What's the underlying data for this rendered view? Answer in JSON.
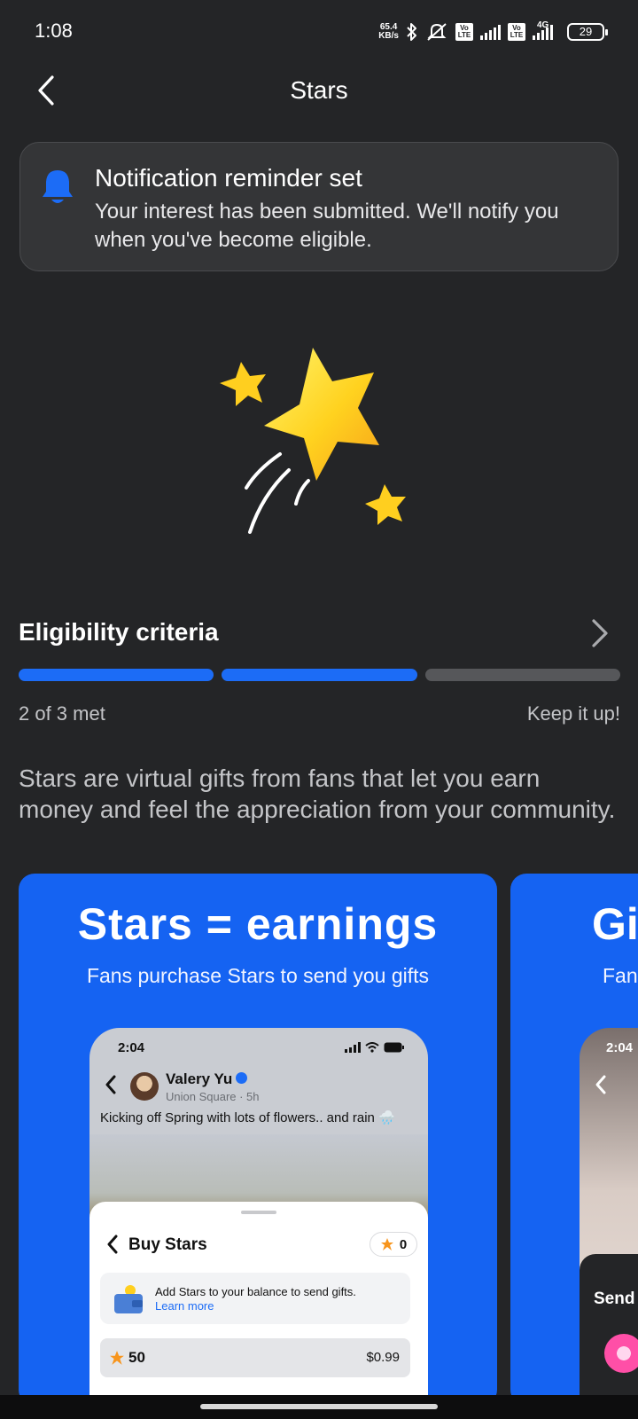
{
  "status_bar": {
    "time": "1:08",
    "net_speed_value": "65.4",
    "net_speed_unit": "KB/s",
    "battery": "29",
    "sim1_badge": "Vo LTE",
    "sim2_badge": "Vo LTE",
    "network": "4G"
  },
  "header": {
    "title": "Stars"
  },
  "notification": {
    "title": "Notification reminder set",
    "body": "Your interest has been submitted. We'll notify you when you've become eligible.",
    "icon": "bell-icon",
    "accent": "#1c6cf6"
  },
  "eligibility": {
    "title": "Eligibility criteria",
    "met_text": "2 of 3 met",
    "encouragement": "Keep it up!",
    "criteria_met": 2,
    "criteria_total": 3
  },
  "description": "Stars are virtual gifts from fans that let you earn money and feel the appreciation from your community.",
  "carousel": {
    "cards": [
      {
        "title": "Stars = earnings",
        "subtitle": "Fans purchase Stars to send you gifts",
        "mockup": {
          "time": "2:04",
          "user_name": "Valery Yu",
          "location": "Union Square · 5h",
          "post_text": "Kicking off Spring with lots of flowers.. and rain 🌧️",
          "sheet_title": "Buy Stars",
          "balance": "0",
          "info_text": "Add Stars to your balance to send gifts.",
          "info_link": "Learn more",
          "option_amount": "50",
          "option_price": "$0.99"
        }
      },
      {
        "title": "Gi",
        "subtitle": "Fan",
        "mockup": {
          "time": "2:04",
          "send_label": "Send"
        }
      }
    ]
  },
  "colors": {
    "background": "#242527",
    "accent": "#1c6cf6",
    "card_blue": "#1563f2"
  }
}
